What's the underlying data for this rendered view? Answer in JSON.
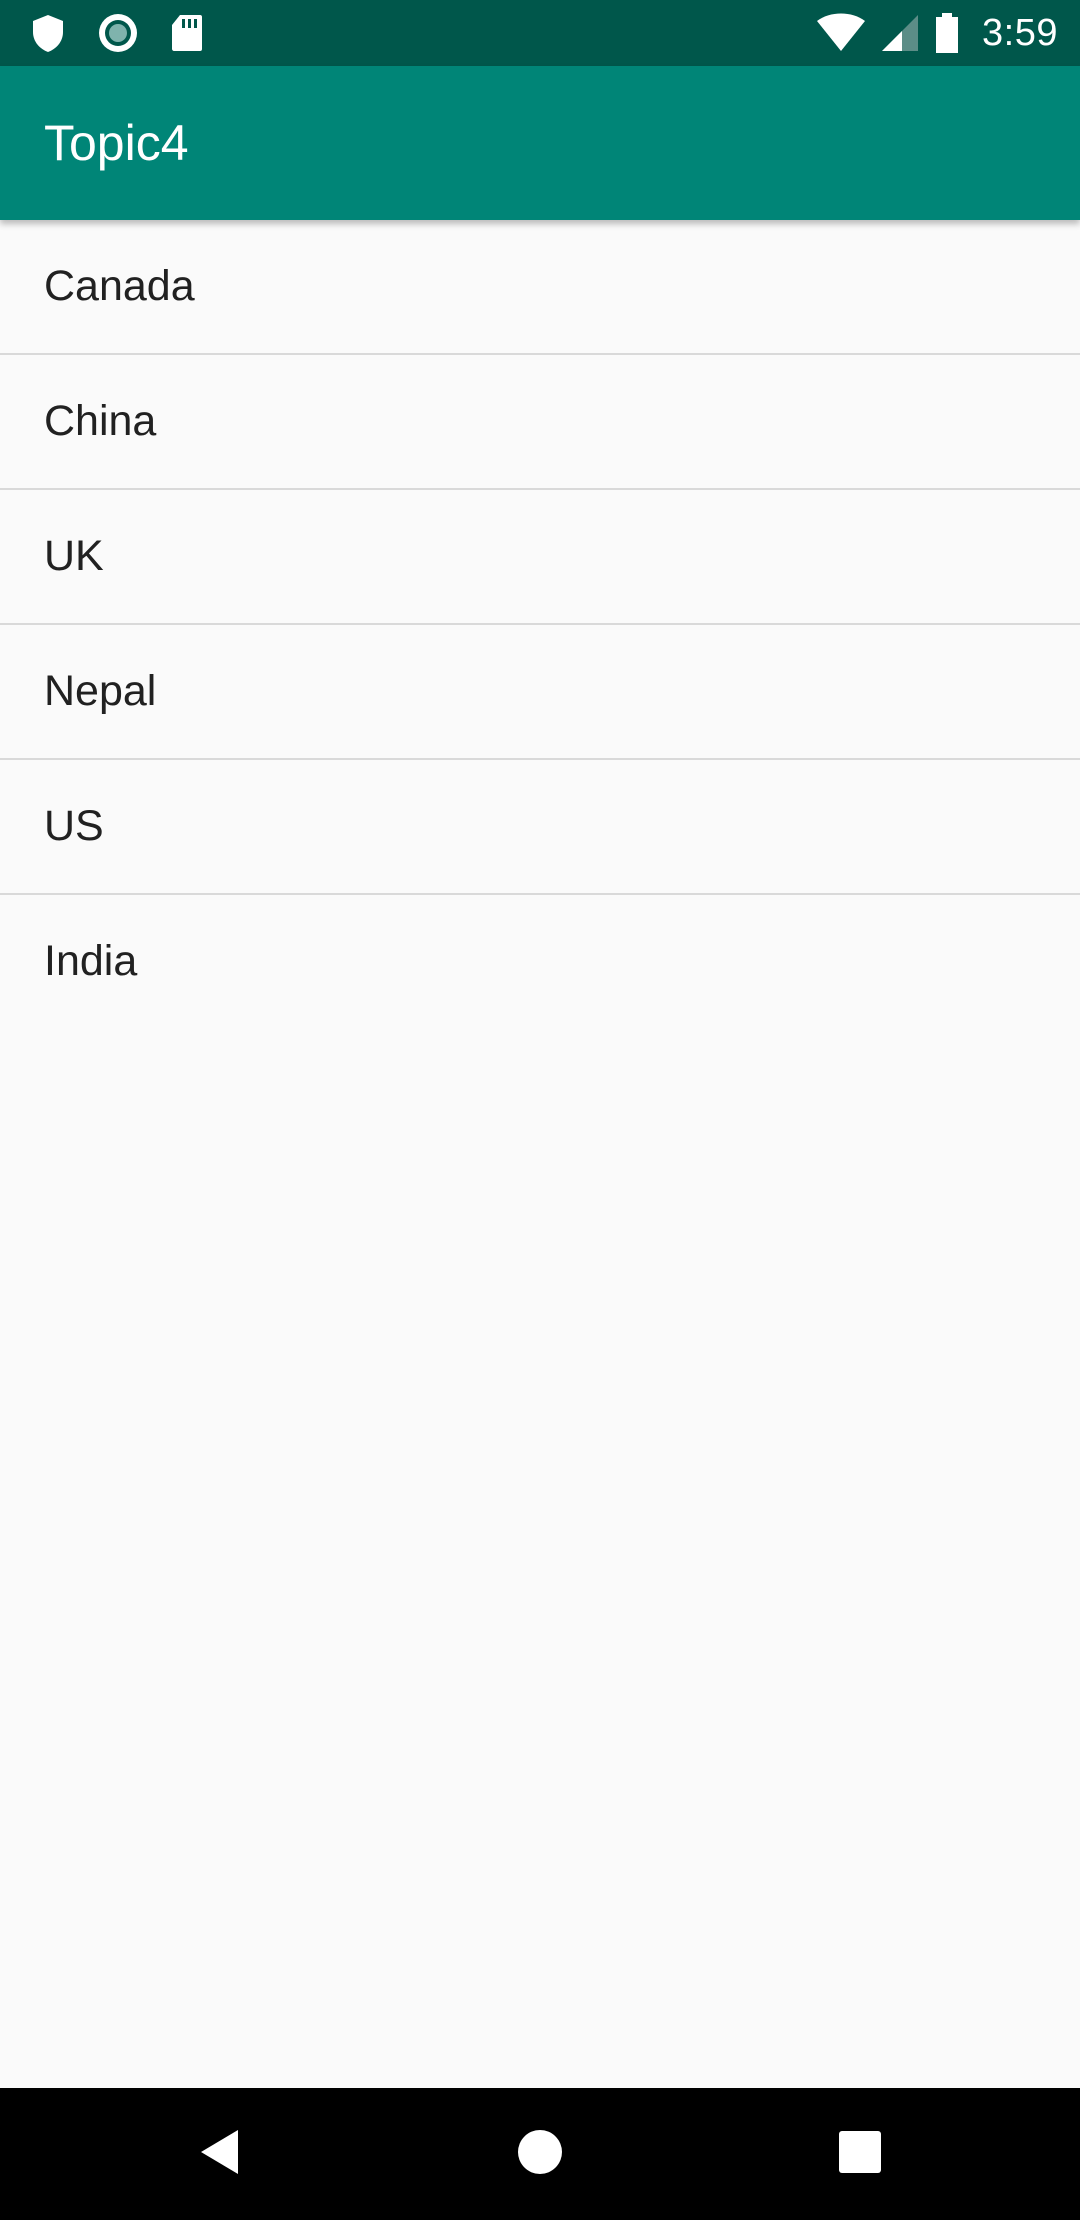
{
  "status_bar": {
    "time": "3:59",
    "left_icons": [
      "shield-icon",
      "circle-record-icon",
      "sd-card-icon"
    ],
    "right_icons": [
      "wifi-icon",
      "cell-signal-icon",
      "battery-icon"
    ],
    "background": "#00574b"
  },
  "app_bar": {
    "title": "Topic4",
    "background": "#008577"
  },
  "list": {
    "items": [
      {
        "label": "Canada"
      },
      {
        "label": "China"
      },
      {
        "label": "UK"
      },
      {
        "label": "Nepal"
      },
      {
        "label": "US"
      },
      {
        "label": "India"
      }
    ]
  },
  "nav_bar": {
    "buttons": [
      "back-icon",
      "home-icon",
      "recents-icon"
    ]
  }
}
